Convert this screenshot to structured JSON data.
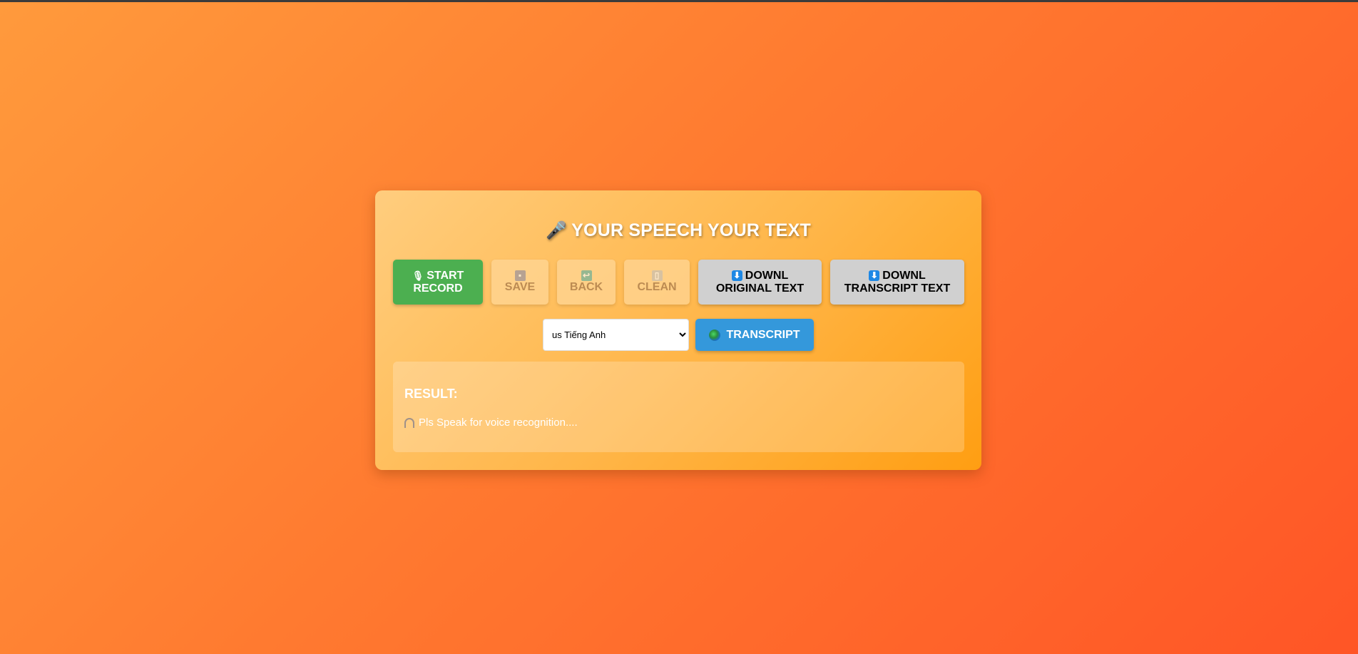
{
  "app": {
    "title": "YOUR SPEECH YOUR TEXT",
    "title_icon": "🎤"
  },
  "toolbar": {
    "start": {
      "icon": "microphone-icon",
      "glyph": "🎙",
      "line1": "START",
      "line2": "RECORD"
    },
    "save": {
      "icon": "floppy-disk-icon",
      "glyph": "💾",
      "label": "SAVE"
    },
    "back": {
      "icon": "undo-icon",
      "glyph": "↩",
      "label": "BACK"
    },
    "clean": {
      "icon": "trash-icon",
      "glyph": "🗑",
      "label": "CLEAN"
    },
    "download_original": {
      "icon": "download-icon",
      "glyph": "⬇",
      "line1": "DOWNL",
      "line2": "ORIGINAL TEXT"
    },
    "download_transcript": {
      "icon": "download-icon",
      "glyph": "⬇",
      "line1": "DOWNL",
      "line2": "TRANSCRIPT TEXT"
    }
  },
  "language": {
    "selected": "us Tiếng Anh"
  },
  "transcript_button": {
    "icon": "globe-icon",
    "label": "TRANSCRIPT"
  },
  "result": {
    "title": "RESULT:",
    "icon": "headphone-icon",
    "text": "Pls Speak for voice recognition...."
  },
  "colors": {
    "start_button": "#4caf50",
    "transcript_button": "#3498db",
    "download_button": "#d0d0d0",
    "background_start": "#ff9a3c",
    "background_end": "#ff5526"
  }
}
